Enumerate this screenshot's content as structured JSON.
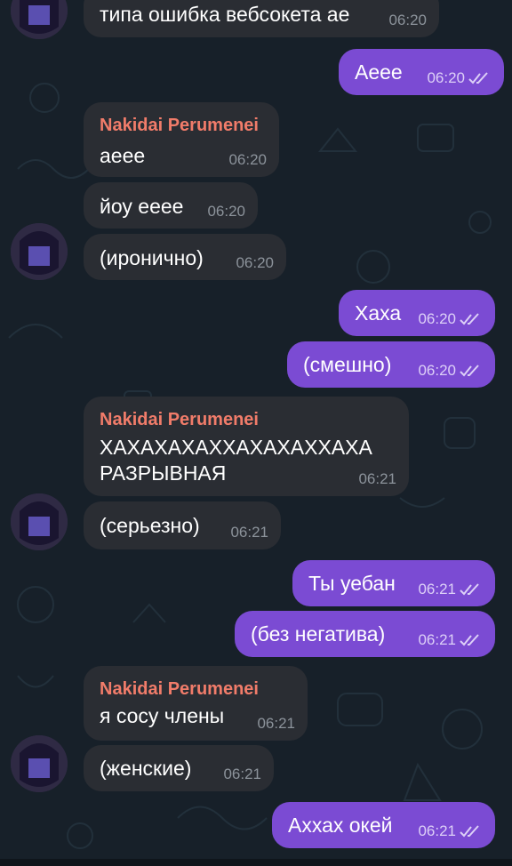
{
  "colors": {
    "background": "#172029",
    "incoming_bubble": "#2a2d33",
    "outgoing_bubble": "#7b4bd3",
    "sender_name": "#f17c6a",
    "incoming_time": "#8c939b",
    "outgoing_time": "#ddd0f7"
  },
  "icons": {
    "read_receipt": "double-check-icon",
    "avatar": "pixel-character-avatar"
  },
  "messages": [
    {
      "text": "типа ошибка вебсокета ае",
      "time": "06:20"
    },
    {
      "text": "Аеее",
      "time": "06:20"
    },
    {
      "sender": "Nakidai Perumenei",
      "text": "аеее",
      "time": "06:20"
    },
    {
      "text": "йоу ееее",
      "time": "06:20"
    },
    {
      "text": "(иронично)",
      "time": "06:20"
    },
    {
      "text": "Хаха",
      "time": "06:20"
    },
    {
      "text": "(смешно)",
      "time": "06:20"
    },
    {
      "sender": "Nakidai Perumenei",
      "text1": "ХАХАХАХАХХАХАХАХХАХА",
      "text2": "РАЗРЫВНАЯ",
      "time": "06:21"
    },
    {
      "text": "(серьезно)",
      "time": "06:21"
    },
    {
      "text": "Ты уебан",
      "time": "06:21"
    },
    {
      "text": "(без негатива)",
      "time": "06:21"
    },
    {
      "sender": "Nakidai Perumenei",
      "text": "я сосу члены",
      "time": "06:21"
    },
    {
      "text": "(женские)",
      "time": "06:21"
    },
    {
      "text": "Аххах окей",
      "time": "06:21"
    }
  ]
}
